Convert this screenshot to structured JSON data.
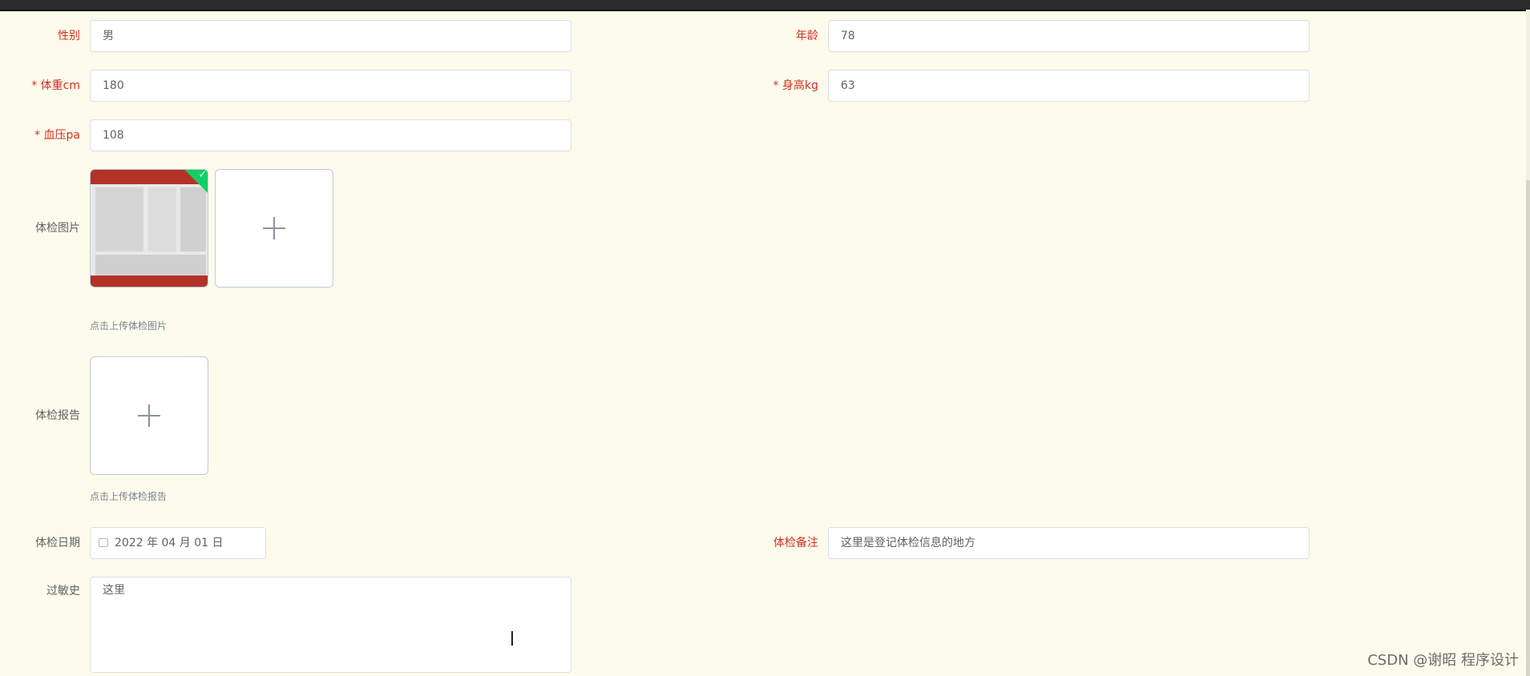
{
  "form": {
    "gender": {
      "label": "性别",
      "value": "男"
    },
    "age": {
      "label": "年龄",
      "value": "78"
    },
    "weight": {
      "label": "* 体重cm",
      "value": "180"
    },
    "height": {
      "label": "* 身高kg",
      "value": "63"
    },
    "blood_pressure": {
      "label": "* 血压pa",
      "value": "108"
    },
    "exam_image": {
      "label": "体检图片",
      "hint": "点击上传体检图片"
    },
    "exam_report": {
      "label": "体检报告",
      "hint": "点击上传体检报告"
    },
    "exam_date": {
      "label": "体检日期",
      "value": "2022 年 04 月 01 日"
    },
    "exam_note": {
      "label": "体检备注",
      "value": "这里是登记体检信息的地方"
    },
    "allergy": {
      "label": "过敏史",
      "value": "这里"
    }
  },
  "watermark": "CSDN @谢昭  程序设计",
  "icons": {
    "calendar": "calendar-icon",
    "plus": "plus-icon",
    "check": "check-icon"
  },
  "colors": {
    "required_label": "#d0311f",
    "background": "#fdfbec",
    "success": "#13ce66"
  }
}
